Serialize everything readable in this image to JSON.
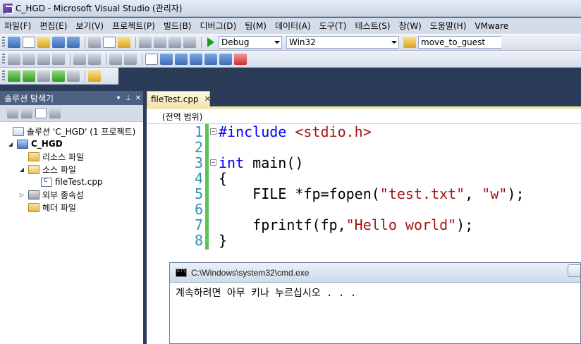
{
  "window": {
    "title": "C_HGD - Microsoft Visual Studio (관리자)"
  },
  "menu": [
    "파일(F)",
    "편집(E)",
    "보기(V)",
    "프로젝트(P)",
    "빌드(B)",
    "디버그(D)",
    "팀(M)",
    "데이터(A)",
    "도구(T)",
    "테스트(S)",
    "창(W)",
    "도움말(H)",
    "VMware"
  ],
  "toolbar": {
    "configuration": "Debug",
    "platform": "Win32",
    "find_text": "move_to_guest"
  },
  "solution_explorer": {
    "title": "솔루션 탐색기",
    "solution_label": "솔루션 'C_HGD' (1 프로젝트)",
    "project_label": "C_HGD",
    "resources_label": "리소스 파일",
    "sources_label": "소스 파일",
    "file_label": "fileTest.cpp",
    "external_deps_label": "외부 종속성",
    "headers_label": "헤더 파일"
  },
  "editor": {
    "tab_label": "fileTest.cpp",
    "scope": "(전역 범위)",
    "lines": [
      {
        "num": "1",
        "fold": "⊟",
        "parts": [
          {
            "t": "#include",
            "c": "kw"
          },
          {
            "t": " ",
            "c": "pl"
          },
          {
            "t": "<stdio.h>",
            "c": "str"
          }
        ]
      },
      {
        "num": "2",
        "fold": "",
        "parts": []
      },
      {
        "num": "3",
        "fold": "⊟",
        "parts": [
          {
            "t": "int",
            "c": "kw"
          },
          {
            "t": " main()",
            "c": "pl"
          }
        ]
      },
      {
        "num": "4",
        "fold": "",
        "parts": [
          {
            "t": "{",
            "c": "pl"
          }
        ]
      },
      {
        "num": "5",
        "fold": "",
        "parts": [
          {
            "t": "    FILE *fp=fopen(",
            "c": "pl"
          },
          {
            "t": "\"test.txt\"",
            "c": "str"
          },
          {
            "t": ", ",
            "c": "pl"
          },
          {
            "t": "\"w\"",
            "c": "str"
          },
          {
            "t": ");",
            "c": "pl"
          }
        ]
      },
      {
        "num": "6",
        "fold": "",
        "parts": []
      },
      {
        "num": "7",
        "fold": "",
        "parts": [
          {
            "t": "    fprintf(fp,",
            "c": "pl"
          },
          {
            "t": "\"Hello world\"",
            "c": "str"
          },
          {
            "t": ");",
            "c": "pl"
          }
        ]
      },
      {
        "num": "8",
        "fold": "",
        "parts": [
          {
            "t": "}",
            "c": "pl"
          }
        ]
      }
    ]
  },
  "console": {
    "title": "C:\\Windows\\system32\\cmd.exe",
    "output": "계속하려면 아무 키나 누르십시오 . . ."
  }
}
